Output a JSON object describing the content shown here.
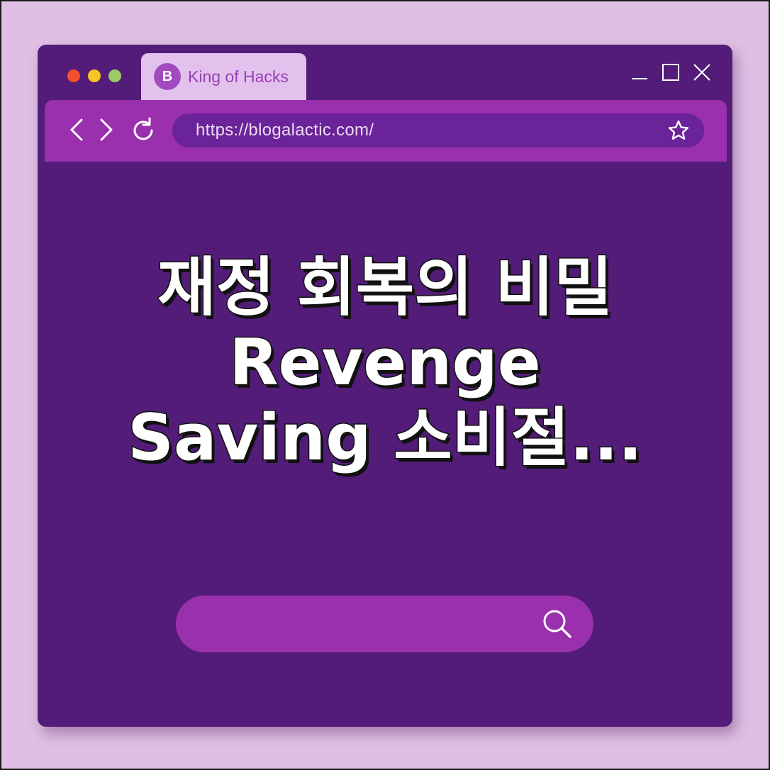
{
  "tab": {
    "favicon_letter": "B",
    "title": "King of Hacks"
  },
  "toolbar": {
    "url": "https://blogalactic.com/",
    "back_icon": "chevron-left-icon",
    "forward_icon": "chevron-right-icon",
    "reload_icon": "reload-icon",
    "bookmark_icon": "star-icon"
  },
  "headline": {
    "line1": "재정 회복의 비밀",
    "line2": "Revenge",
    "line3": "Saving 소비절..."
  },
  "colors": {
    "page_background": "#e0bfe4",
    "window_background": "#521c78",
    "toolbar": "#9a30ae",
    "url_bar": "#6a2398",
    "tab": "#e2c2ec",
    "accent": "#a24bc0"
  }
}
